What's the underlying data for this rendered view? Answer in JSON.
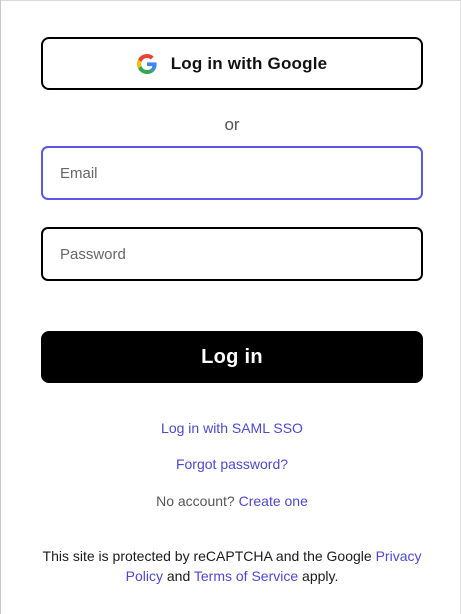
{
  "google_button": {
    "label": "Log in with Google",
    "icon": "google-g-icon"
  },
  "separator": "or",
  "email": {
    "placeholder": "Email",
    "value": ""
  },
  "password": {
    "placeholder": "Password",
    "value": ""
  },
  "login_button": {
    "label": "Log in"
  },
  "links": {
    "saml": "Log in with SAML SSO",
    "forgot": "Forgot password?",
    "no_account_text": "No account?",
    "create": "Create one"
  },
  "recaptcha": {
    "prefix": "This site is protected by reCAPTCHA and the Google",
    "privacy": "Privacy Policy",
    "and": "and",
    "terms": "Terms of Service",
    "suffix": "apply."
  },
  "colors": {
    "accent": "#4c47d9",
    "focus_border": "#5b56e8",
    "primary_button": "#000000"
  }
}
